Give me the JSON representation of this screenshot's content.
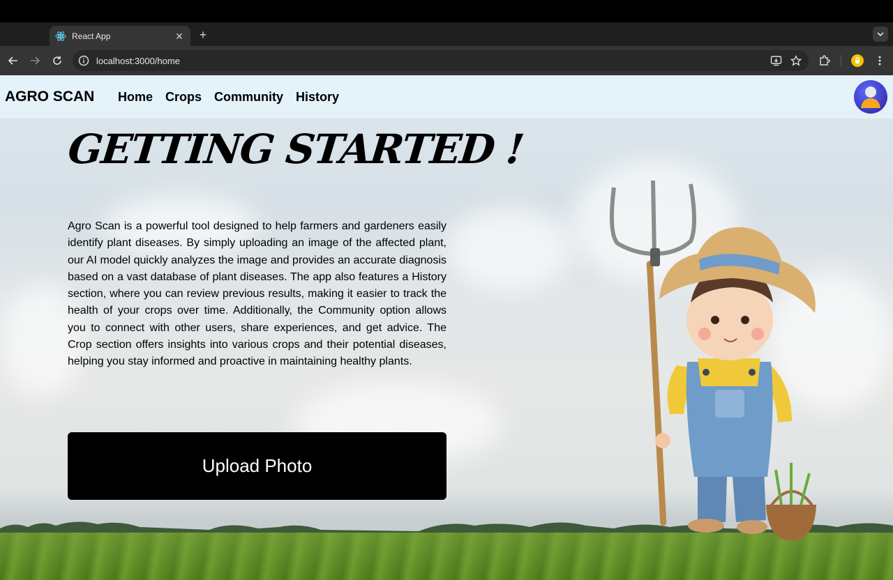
{
  "browser": {
    "tab_title": "React App",
    "url": "localhost:3000/home",
    "favicon": "react-icon",
    "icons": {
      "tab_close": "close-icon",
      "new_tab": "plus-icon",
      "tab_search": "chevron-down-icon",
      "back": "back-arrow-icon",
      "forward": "forward-arrow-icon",
      "reload": "reload-icon",
      "site_info": "info-icon",
      "install": "install-app-icon",
      "bookmark": "star-icon",
      "extensions": "puzzle-icon",
      "profile": "profile-icon",
      "menu": "kebab-menu-icon"
    }
  },
  "navbar": {
    "brand": "AGRO SCAN",
    "links": [
      {
        "label": "Home"
      },
      {
        "label": "Crops"
      },
      {
        "label": "Community"
      },
      {
        "label": "History"
      }
    ],
    "avatar_icon": "user-avatar-icon"
  },
  "hero": {
    "title": "GETTING STARTED !",
    "description": "Agro Scan is a powerful tool designed to help farmers and gardeners easily identify plant diseases. By simply uploading an image of the affected plant, our AI model quickly analyzes the image and provides an accurate diagnosis based on a vast database of plant diseases. The app also features a History section, where you can review previous results, making it easier to track the health of your crops over time. Additionally, the Community option allows you to connect with other users, share experiences, and get advice. The Crop section offers insights into various crops and their potential diseases, helping you stay informed and proactive in maintaining healthy plants.",
    "upload_button": "Upload Photo"
  },
  "colors": {
    "navbar_bg": "#e4f3fa",
    "button_bg": "#000000",
    "avatar": "#3b34b8",
    "field": "#5d8a23"
  }
}
